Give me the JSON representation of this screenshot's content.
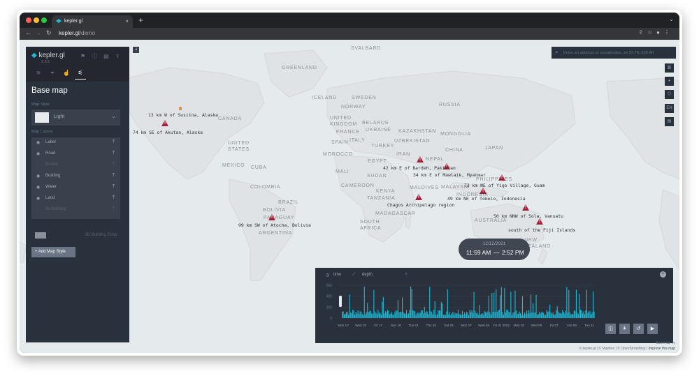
{
  "browser": {
    "tab_title": "kepler.gl",
    "tab_close": "×",
    "new_tab": "+",
    "url_host": "kepler.gl",
    "url_path": "/demo",
    "back": "←",
    "forward": "→",
    "reload": "↻"
  },
  "panel": {
    "logo": "kepler.gl",
    "version": "2.5.5",
    "title": "Base map",
    "map_style_label": "Map Style",
    "selected_style": "Light",
    "map_layers_label": "Map Layers",
    "layers": [
      {
        "name": "Label",
        "visible": true
      },
      {
        "name": "Road",
        "visible": true
      },
      {
        "name": "Border",
        "visible": false
      },
      {
        "name": "Building",
        "visible": true
      },
      {
        "name": "Water",
        "visible": true
      },
      {
        "name": "Land",
        "visible": true
      },
      {
        "name": "3d Building",
        "visible": false
      }
    ],
    "building_color_label": "3D Building Color",
    "add_style_button": "+ Add Map Style"
  },
  "geocoder": {
    "placeholder": "Enter an address or coordinates, ex 37.79,-122.40"
  },
  "map_controls": [
    "layers-icon",
    "legend-icon",
    "draw-icon",
    "EN",
    "split-icon"
  ],
  "map_labels": [
    "SVALBARD",
    "GREENLAND",
    "ICELAND",
    "SWEDEN",
    "NORWAY",
    "RUSSIA",
    "UNITED KINGDOM",
    "BELARUS",
    "UKRAINE",
    "FRANCE",
    "KAZAKHSTAN",
    "MONGOLIA",
    "SPAIN",
    "ITALY",
    "UZBEKISTAN",
    "TURKEY",
    "MOROCCO",
    "IRAN",
    "CHINA",
    "JAPAN",
    "EGYPT",
    "NEPAL",
    "MALI",
    "SUDAN",
    "PHILIPPINES",
    "CAMEROON",
    "KENYA",
    "TANZANIA",
    "MALDIVES",
    "MALAYSIA",
    "INDONESIA",
    "MADAGASCAR",
    "AUSTRALIA",
    "SOUTH AFRICA",
    "CANADA",
    "UNITED STATES",
    "MEXICO",
    "CUBA",
    "COLOMBIA",
    "BRAZIL",
    "BOLIVIA",
    "PARAGUAY",
    "ARGENTINA",
    "NEW ZEALAND"
  ],
  "events": [
    "13 km W of Susitna, Alaska",
    "74 km SE of Akutan, Alaska",
    "42 km E of Bardeh, Pakistan",
    "34 km E of Mawlaik, Myanmar",
    "73 km NE of Yigo Village, Guam",
    "49 km NE of Tobelo, Indonesia",
    "Chagos Archipelago region",
    "50 km NNW of Sola, Vanuatu",
    "south of the Fiji Islands",
    "99 km SW of Atocha, Bolivia"
  ],
  "time_display": {
    "date": "12/12/2021",
    "start": "11:59 AM",
    "dash": "—",
    "end": "2:52 PM"
  },
  "timeline": {
    "time_field": "time",
    "value_field": "depth",
    "close": "×",
    "y_ticks": [
      "600",
      "400",
      "200",
      "0"
    ],
    "x_ticks": [
      "Mon 13",
      "Wed 15",
      "Fri 17",
      "Dec 19",
      "Tue 21",
      "Thu 23",
      "Sat 25",
      "Mon 27",
      "Wed 29",
      "Fri 31 2022",
      "Mon 03",
      "Wed 05",
      "Fri 07",
      "Jan 09",
      "Tue 11"
    ],
    "bar_color": "#1fbad6"
  },
  "attribution": {
    "basemap_by": "Basemap by",
    "text": "© kepler.gl | © Mapbox | © OpenStreetMap |",
    "improve": "Improve this map"
  },
  "colors": {
    "panel_bg": "#29323c",
    "accent": "#1fbad6",
    "marker": "#a3203a",
    "map_water": "#e5eaec"
  }
}
